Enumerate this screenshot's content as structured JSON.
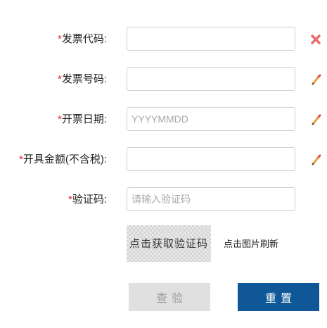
{
  "form": {
    "required_mark": "*",
    "invoice_code": {
      "label": "发票代码:",
      "value": "",
      "placeholder": "",
      "status_icon": "close-icon"
    },
    "invoice_number": {
      "label": "发票号码:",
      "value": "",
      "placeholder": "",
      "status_icon": "pencil-icon"
    },
    "issue_date": {
      "label": "开票日期:",
      "value": "",
      "placeholder": "YYYYMMDD",
      "status_icon": "pencil-icon"
    },
    "amount": {
      "label": "开具金额(不含税):",
      "value": "",
      "placeholder": "",
      "status_icon": "pencil-icon"
    },
    "captcha": {
      "label": "验证码:",
      "value": "",
      "placeholder": "请输入验证码"
    }
  },
  "captcha_image": {
    "text": "点击获取验证码"
  },
  "refresh_hint": "点击图片刷新",
  "buttons": {
    "check": "查验",
    "reset": "重置"
  },
  "colors": {
    "required": "#e8202a",
    "reset_bg": "#0f5797",
    "check_bg": "#e0e0e0",
    "error_icon": "#e34b4b",
    "pencil_icon": "#e9a23b"
  }
}
